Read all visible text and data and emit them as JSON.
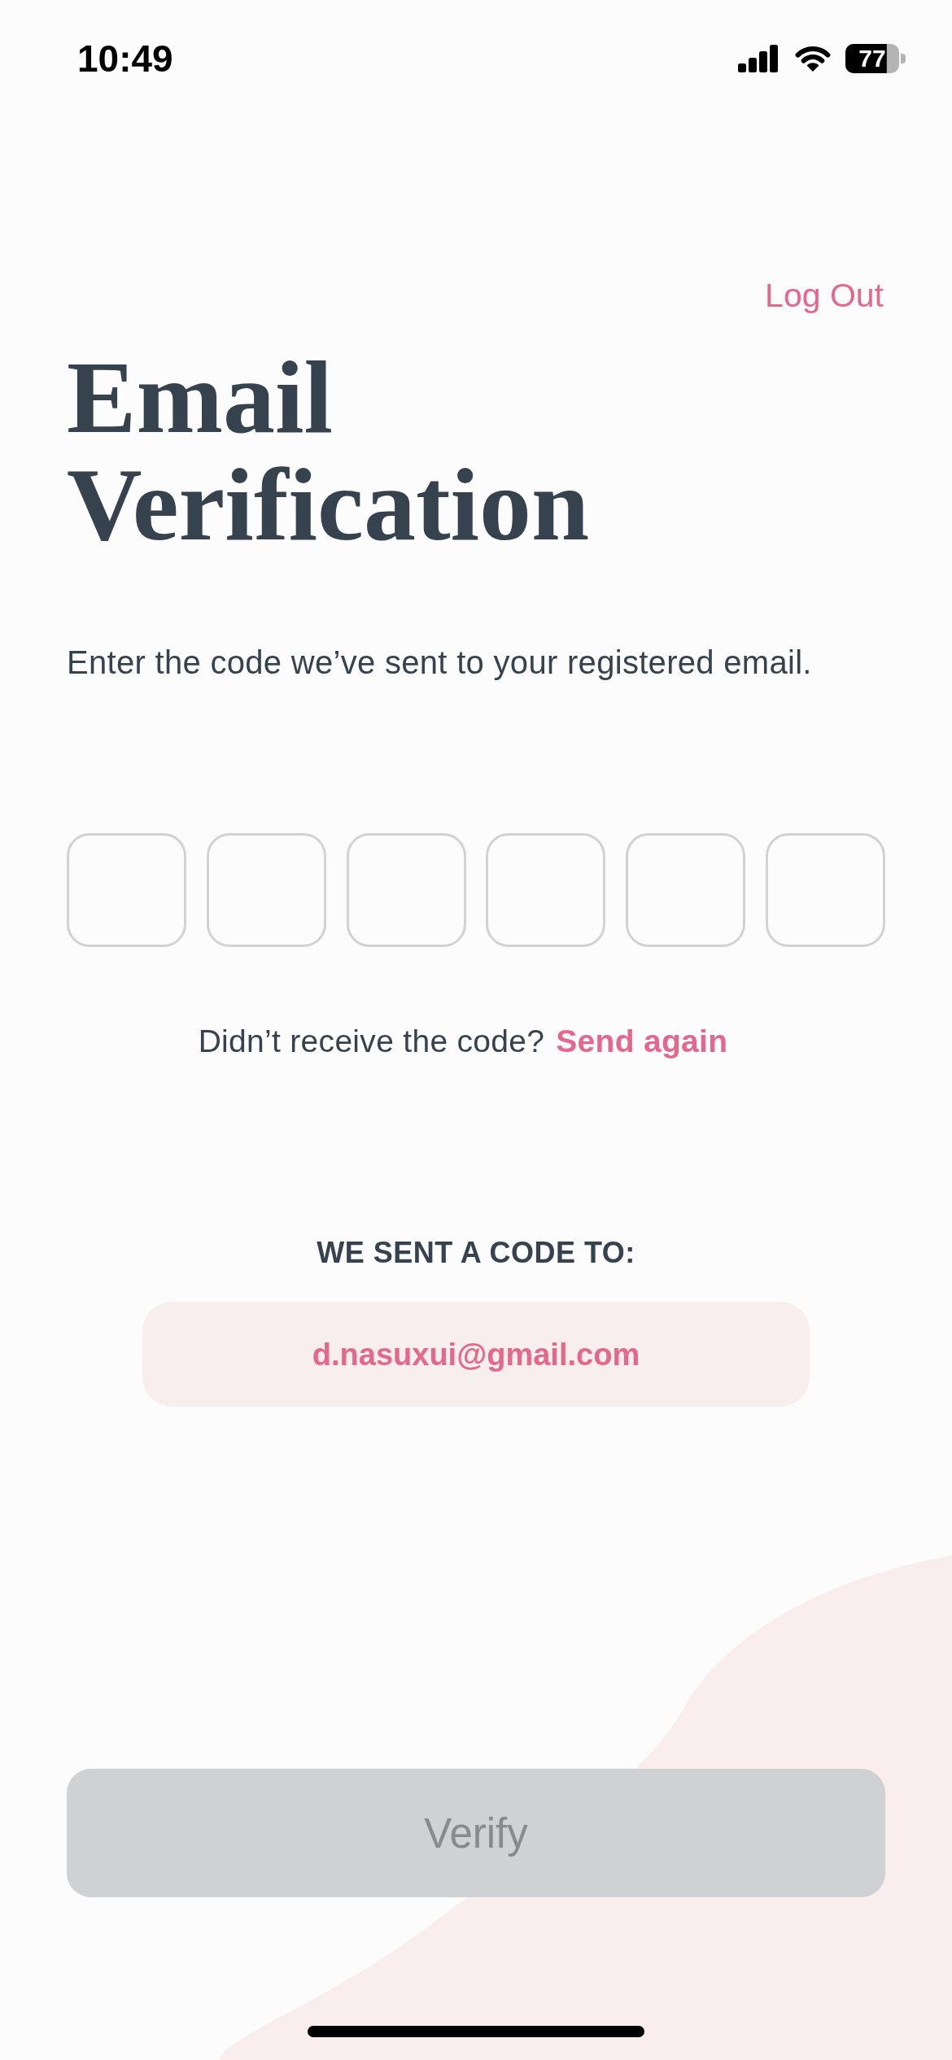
{
  "status_bar": {
    "time": "10:49",
    "battery": "77"
  },
  "log_out": "Log Out",
  "title": "Email Verification",
  "instruction": "Enter the code we’ve sent to your registered email.",
  "code_fields": [
    {
      "focused": false
    },
    {
      "focused": false
    },
    {
      "focused": false
    },
    {
      "focused": false
    },
    {
      "focused": false
    },
    {
      "focused": false
    }
  ],
  "resend": {
    "prompt": "Didn’t receive the code?",
    "link": "Send again"
  },
  "sent_to": {
    "label": "WE SENT A CODE TO:",
    "email": "d.nasuxui@gmail.com"
  },
  "verify_button": {
    "label": "Verify",
    "disabled": true
  }
}
